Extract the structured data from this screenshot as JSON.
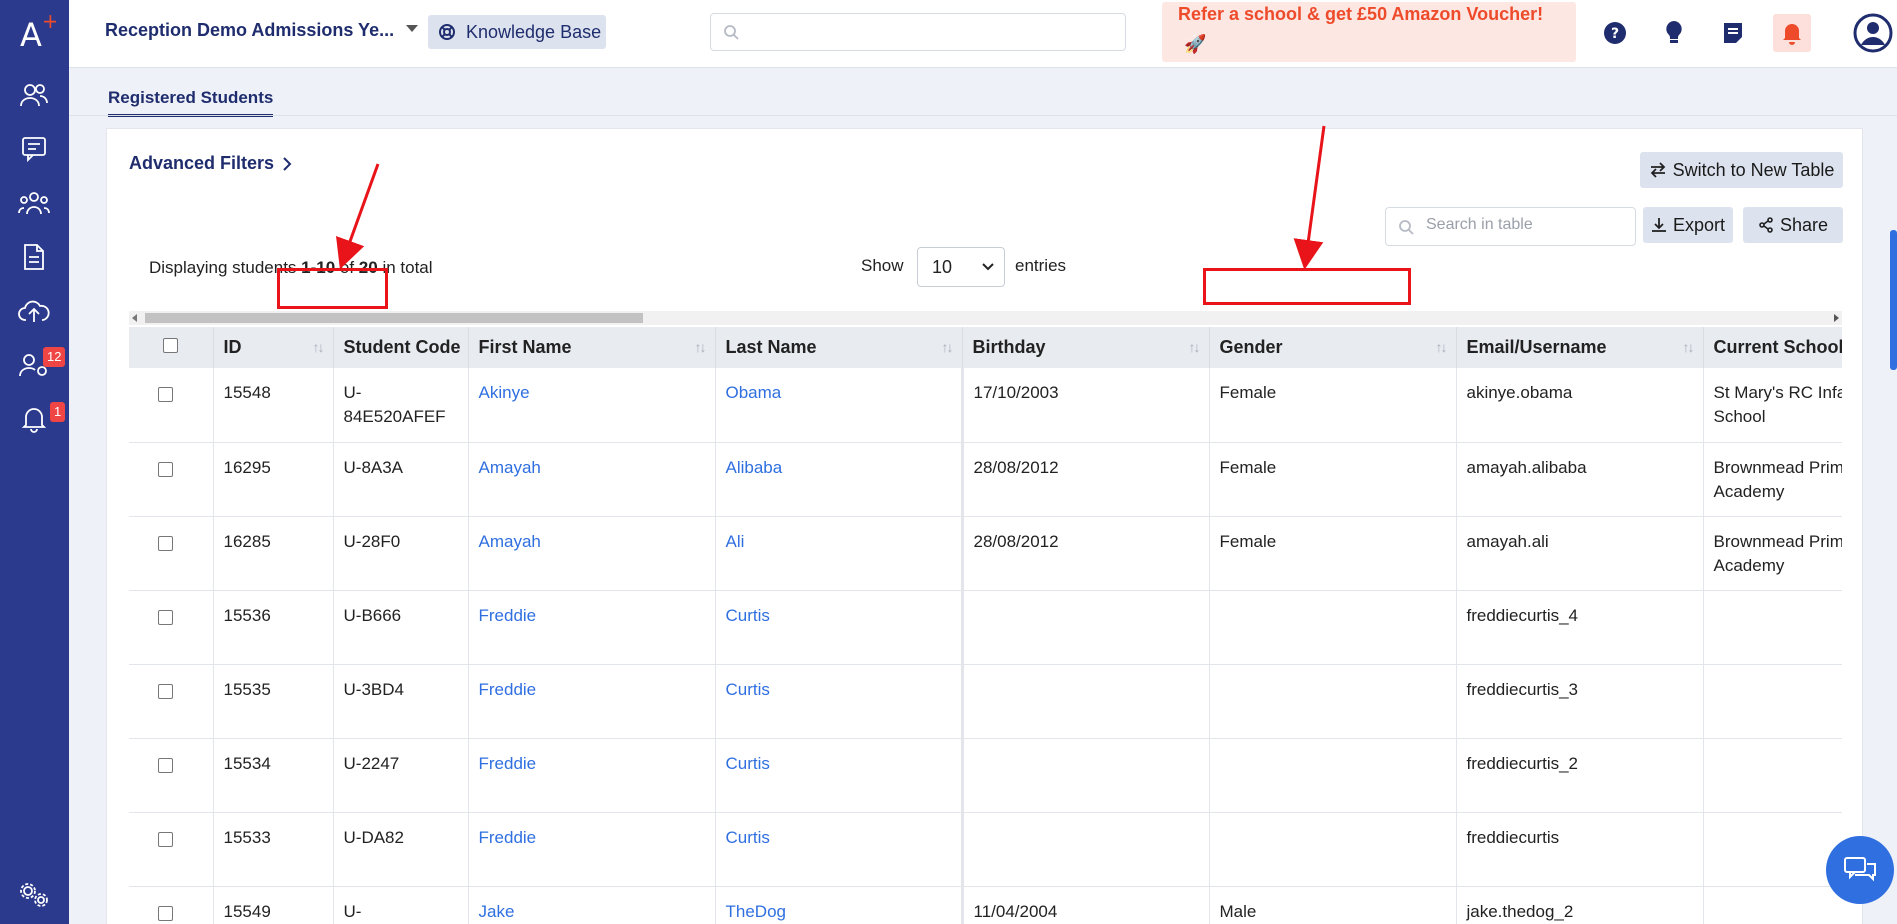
{
  "header": {
    "school_name": "Reception Demo Admissions Ye...",
    "knowledge_base": "Knowledge Base",
    "search_placeholder": "",
    "refer_text": "Refer a school & get £50 Amazon Voucher!",
    "refer_emoji": "🚀"
  },
  "sidebar": {
    "badges": {
      "users": "12",
      "notifications": "1"
    },
    "icons": [
      "users-icon",
      "message-icon",
      "group-icon",
      "document-icon",
      "cloud-upload-icon",
      "user-settings-icon",
      "bell-icon",
      "settings-icon"
    ]
  },
  "tabs": {
    "active": "Registered Students"
  },
  "toolbar": {
    "advanced_filters": "Advanced Filters",
    "switch_table": "Switch to New Table",
    "search_placeholder": "Search in table",
    "export": "Export",
    "share": "Share",
    "display_prefix": "Displaying students ",
    "display_range": "1-10",
    "display_of": " of ",
    "display_total": "20",
    "display_suffix": " in total",
    "show_label": "Show",
    "entries_value": "10",
    "entries_label": "entries"
  },
  "table": {
    "columns": [
      "ID",
      "Student Code",
      "First Name",
      "Last Name",
      "Birthday",
      "Gender",
      "Email/Username",
      "Current School"
    ],
    "rows": [
      [
        "15548",
        "U-84E520AFEF",
        "Akinye",
        "Obama",
        "17/10/2003",
        "Female",
        "akinye.obama",
        "St Mary's RC Infant School"
      ],
      [
        "16295",
        "U-8A3A",
        "Amayah",
        "Alibaba",
        "28/08/2012",
        "Female",
        "amayah.alibaba",
        "Brownmead Primary Academy"
      ],
      [
        "16285",
        "U-28F0",
        "Amayah",
        "Ali",
        "28/08/2012",
        "Female",
        "amayah.ali",
        "Brownmead Primary Academy"
      ],
      [
        "15536",
        "U-B666",
        "Freddie",
        "Curtis",
        "",
        "",
        "freddiecurtis_4",
        ""
      ],
      [
        "15535",
        "U-3BD4",
        "Freddie",
        "Curtis",
        "",
        "",
        "freddiecurtis_3",
        ""
      ],
      [
        "15534",
        "U-2247",
        "Freddie",
        "Curtis",
        "",
        "",
        "freddiecurtis_2",
        ""
      ],
      [
        "15533",
        "U-DA82",
        "Freddie",
        "Curtis",
        "",
        "",
        "freddiecurtis",
        ""
      ],
      [
        "15549",
        "U-",
        "Jake",
        "TheDog",
        "11/04/2004",
        "Male",
        "jake.thedog_2",
        ""
      ]
    ]
  },
  "colors": {
    "sidebar": "#2b3a8c",
    "accent": "#1f2d6e",
    "link": "#2f6fe0",
    "annotation": "#e8141a"
  }
}
